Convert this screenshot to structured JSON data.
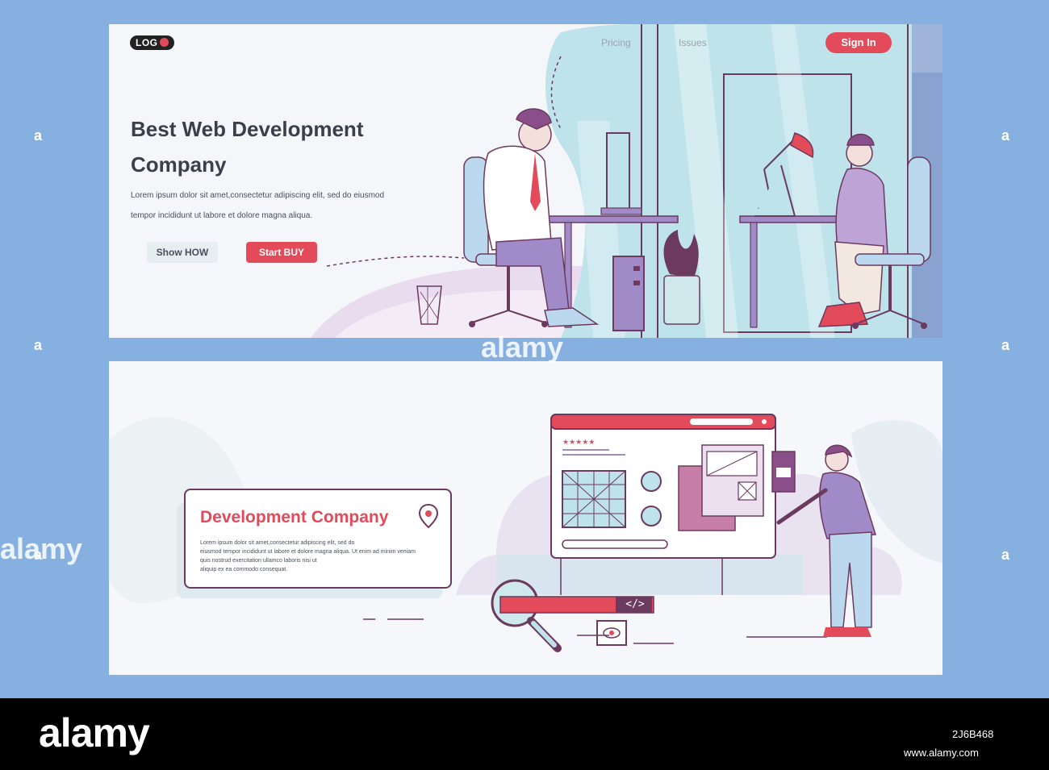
{
  "top_panel": {
    "logo_text": "LOG",
    "nav": [
      "Pricing",
      "Issues"
    ],
    "sign_in": "Sign In",
    "headline_line1": "Best Web Development",
    "headline_line2": "Company",
    "lead_line1": "Lorem ipsum dolor sit amet,consectetur adipiscing elit, sed do eiusmod",
    "lead_line2": "tempor incididunt ut labore et dolore magna aliqua.",
    "button_secondary": "Show HOW",
    "button_primary": "Start BUY"
  },
  "bottom_panel": {
    "title": "Development Company",
    "text_lines": [
      "Lorem ipsum dolor sit amet,consectetur adipiscing elit, sed do",
      "eiusmod tempor incididunt ut labore et dolore magna aliqua. Ut enim ad minim veniam",
      "quis nostrud exercitation ullamco laboris nisi ut",
      "aliquip ex ea commodo consequat."
    ],
    "code_tag": "</>"
  },
  "watermark": {
    "brand": "alamy",
    "side_letter": "a",
    "image_id": "2J6B468",
    "url": "www.alamy.com"
  },
  "colors": {
    "accent": "#e34a5a",
    "outline": "#6b3a5e",
    "background": "#86b0e0",
    "violet": "#a08bc8"
  }
}
